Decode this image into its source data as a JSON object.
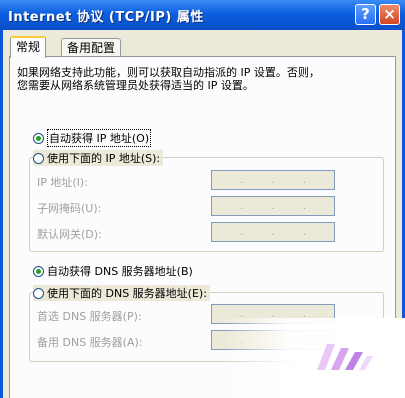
{
  "window": {
    "title": "Internet 协议 (TCP/IP) 属性",
    "help_label": "?",
    "close_label": "×"
  },
  "tabs": [
    {
      "label": "常规",
      "selected": true
    },
    {
      "label": "备用配置",
      "selected": false
    }
  ],
  "description": "如果网络支持此功能，则可以获取自动指派的 IP 设置。否则，\n您需要从网络系统管理员处获得适当的 IP 设置。",
  "ip_section": {
    "auto_label": "自动获得 IP 地址(O)",
    "auto_selected": true,
    "manual_label": "使用下面的 IP 地址(S):",
    "manual_selected": false,
    "fields": [
      {
        "label": "IP 地址(I):",
        "value": ""
      },
      {
        "label": "子网掩码(U):",
        "value": ""
      },
      {
        "label": "默认网关(D):",
        "value": ""
      }
    ]
  },
  "dns_section": {
    "auto_label": "自动获得 DNS 服务器地址(B)",
    "auto_selected": true,
    "manual_label": "使用下面的 DNS 服务器地址(E):",
    "manual_selected": false,
    "fields": [
      {
        "label": "首选 DNS 服务器(P):",
        "value": ""
      },
      {
        "label": "备用 DNS 服务器(A):",
        "value": ""
      }
    ]
  },
  "ip_dot": ".",
  "colors": {
    "titlebar": "#0d5fe0",
    "dialog_bg": "#ece9d8",
    "radio_dot": "#21a121",
    "disabled_text": "#a0a0a0"
  }
}
